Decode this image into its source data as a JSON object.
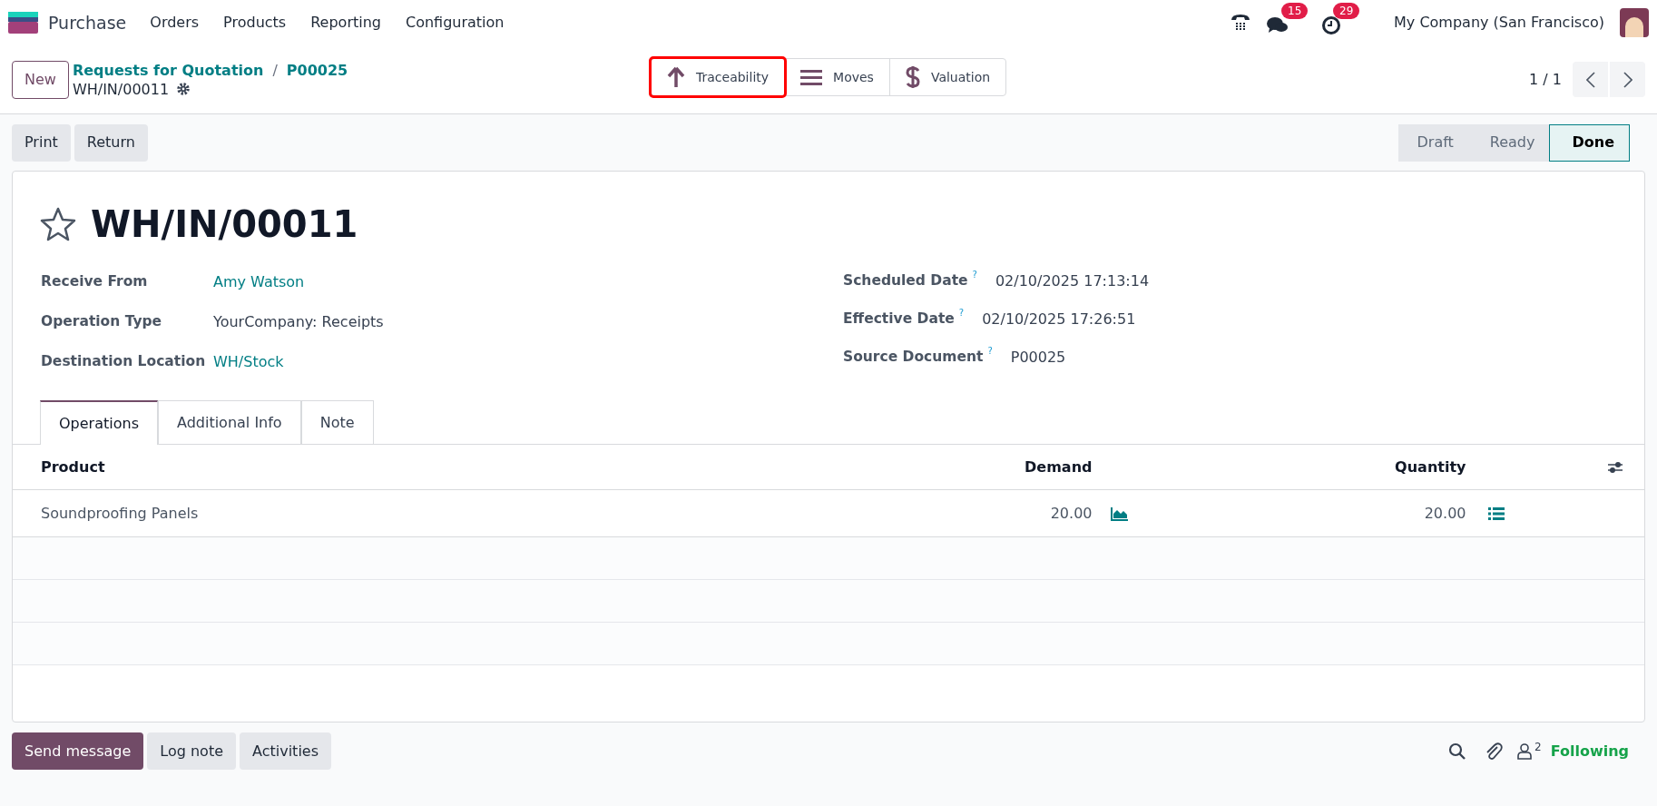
{
  "navbar": {
    "app": "Purchase",
    "menu": [
      "Orders",
      "Products",
      "Reporting",
      "Configuration"
    ],
    "messages_badge": "15",
    "activities_badge": "29",
    "company": "My Company (San Francisco)"
  },
  "control_panel": {
    "new_button": "New",
    "breadcrumbs": [
      "Requests for Quotation",
      "P00025"
    ],
    "separator": "/",
    "record": "WH/IN/00011",
    "smart_buttons": [
      {
        "kind": "arrow",
        "label": "Traceability",
        "highlighted": true
      },
      {
        "kind": "bars",
        "label": "Moves",
        "highlighted": false
      },
      {
        "kind": "dollar",
        "label": "Valuation",
        "highlighted": false
      }
    ],
    "pager": "1 / 1"
  },
  "actions": [
    "Print",
    "Return"
  ],
  "stages": [
    {
      "label": "Draft",
      "selected": false
    },
    {
      "label": "Ready",
      "selected": false
    },
    {
      "label": "Done",
      "selected": true
    }
  ],
  "form": {
    "title": "WH/IN/00011",
    "starred": false,
    "left_fields": [
      {
        "label": "Receive From",
        "value": "Amy Watson",
        "link": true
      },
      {
        "label": "Operation Type",
        "value": "YourCompany: Receipts",
        "link": false
      },
      {
        "label": "Destination Location",
        "value": "WH/Stock",
        "link": true
      }
    ],
    "right_fields": [
      {
        "label": "Scheduled Date",
        "help": "?",
        "value": "02/10/2025 17:13:14"
      },
      {
        "label": "Effective Date",
        "help": "?",
        "value": "02/10/2025 17:26:51"
      },
      {
        "label": "Source Document",
        "help": "?",
        "value": "P00025"
      }
    ],
    "tabs": [
      {
        "label": "Operations",
        "selected": true
      },
      {
        "label": "Additional Info",
        "selected": false
      },
      {
        "label": "Note",
        "selected": false
      }
    ],
    "table": {
      "columns": [
        "Product",
        "Demand",
        "Quantity"
      ],
      "rows": [
        {
          "product": "Soundproofing Panels",
          "demand": "20.00",
          "quantity": "20.00"
        }
      ]
    }
  },
  "chatter": {
    "buttons": [
      {
        "label": "Send message",
        "selected": true
      },
      {
        "label": "Log note",
        "selected": false
      },
      {
        "label": "Activities",
        "selected": false
      }
    ],
    "followers": "2",
    "following": "Following"
  }
}
